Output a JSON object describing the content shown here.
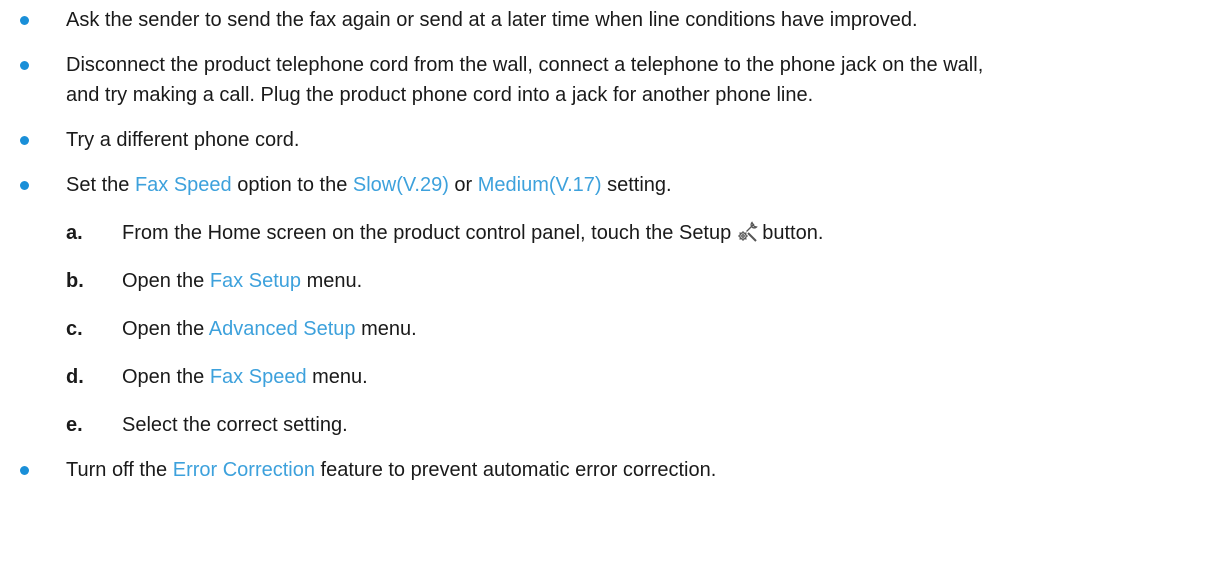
{
  "bullets": [
    {
      "text": "Ask the sender to send the fax again or send at a later time when line conditions have improved."
    },
    {
      "line1": "Disconnect the product telephone cord from the wall, connect a telephone to the phone jack on the wall,",
      "line2": "and try making a call. Plug the product phone cord into a jack for another phone line."
    },
    {
      "text": "Try a different phone cord."
    },
    {
      "pre": "Set the ",
      "kw1": "Fax Speed",
      "mid1": " option to the ",
      "kw2": "Slow(V.29)",
      "mid2": " or ",
      "kw3": "Medium(V.17)",
      "post": " setting."
    },
    {
      "pre": "Turn off the ",
      "kw": "Error Correction",
      "post": " feature to prevent automatic error correction."
    }
  ],
  "steps": [
    {
      "letter": "a.",
      "pre": "From the Home screen on the product control panel, touch the Setup",
      "icon": "setup-wrench-gear-icon",
      "post": "button."
    },
    {
      "letter": "b.",
      "pre": "Open the ",
      "kw": "Fax Setup",
      "post": " menu."
    },
    {
      "letter": "c.",
      "pre": "Open the ",
      "kw": "Advanced Setup",
      "post": " menu."
    },
    {
      "letter": "d.",
      "pre": "Open the ",
      "kw": "Fax Speed",
      "post": " menu."
    },
    {
      "letter": "e.",
      "text": "Select the correct setting."
    }
  ],
  "colors": {
    "keyword": "#3da1dc",
    "bullet": "#1a8fd8",
    "text": "#1a1a1a"
  }
}
